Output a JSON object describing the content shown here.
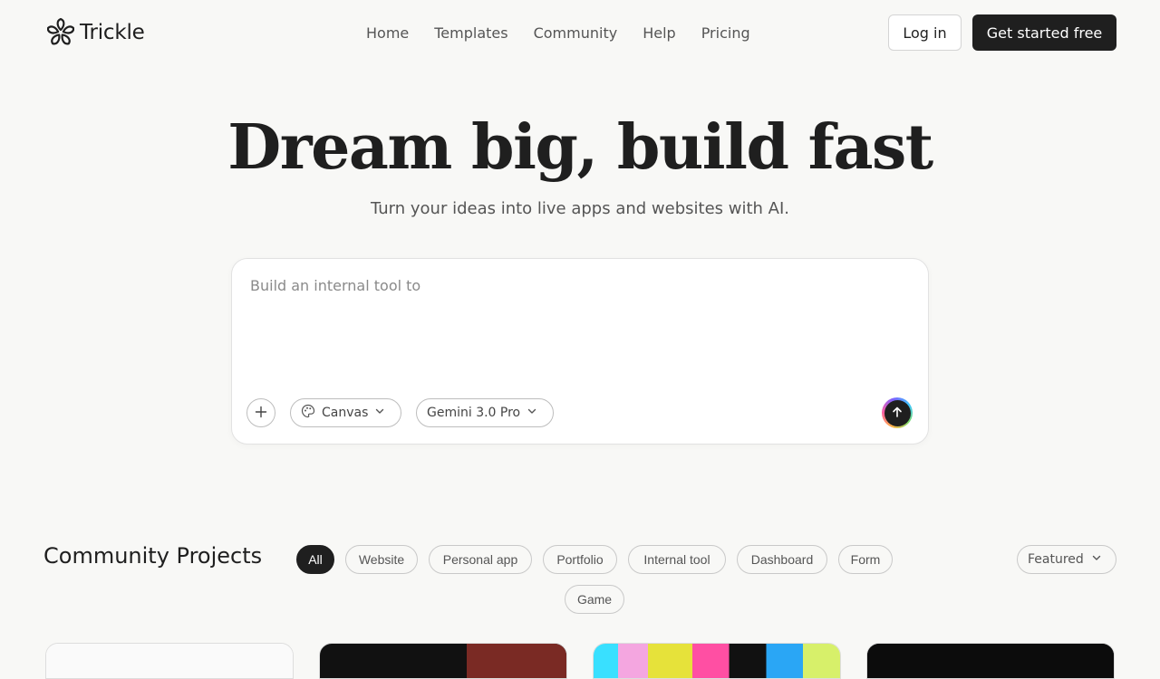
{
  "brand": {
    "name": "Trickle"
  },
  "nav": {
    "items": [
      "Home",
      "Templates",
      "Community",
      "Help",
      "Pricing"
    ]
  },
  "auth": {
    "login": "Log in",
    "cta": "Get started free"
  },
  "hero": {
    "title": "Dream big, build fast",
    "subtitle": "Turn your ideas into live apps and websites with AI."
  },
  "prompt": {
    "placeholder": "Build an internal tool to",
    "value": "",
    "mode": "Canvas",
    "model": "Gemini 3.0 Pro"
  },
  "community": {
    "title": "Community Projects",
    "filters": [
      "All",
      "Website",
      "Personal app",
      "Portfolio",
      "Internal tool",
      "Dashboard",
      "Form",
      "Game"
    ],
    "active_filter": "All",
    "sort": "Featured"
  },
  "icons": {
    "logo": "flower-logo-icon",
    "add": "plus-icon",
    "mode": "palette-icon",
    "dropdown": "chevron-down-icon",
    "send": "arrow-up-icon"
  },
  "colors": {
    "background": "#f8f8f6",
    "primary": "#1f1f1f",
    "text": "#222222",
    "muted": "#555555"
  }
}
